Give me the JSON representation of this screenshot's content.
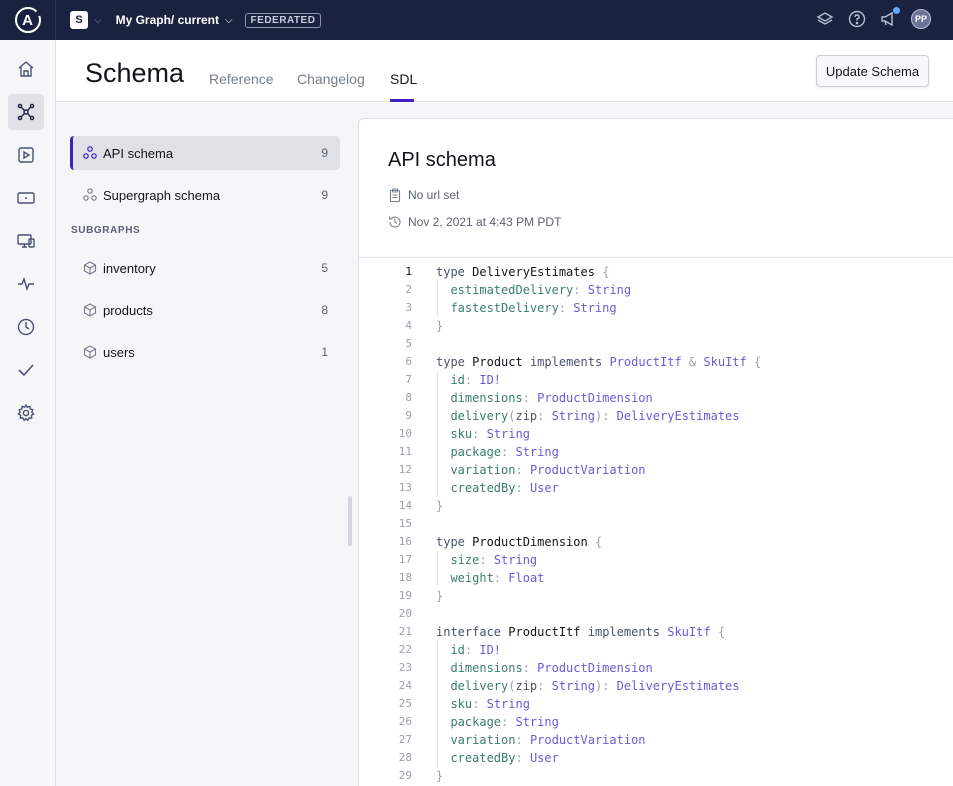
{
  "topbar": {
    "logo_letter": "A",
    "org_initial": "S",
    "graph_name": "My Graph/ current",
    "badge": "FEDERATED",
    "avatar_initials": "PP"
  },
  "header": {
    "title": "Schema",
    "tabs": [
      {
        "label": "Reference",
        "active": false
      },
      {
        "label": "Changelog",
        "active": false
      },
      {
        "label": "SDL",
        "active": true
      }
    ],
    "update_button": "Update Schema"
  },
  "sidebar": {
    "schemas": [
      {
        "label": "API schema",
        "count": "9",
        "active": true
      },
      {
        "label": "Supergraph schema",
        "count": "9",
        "active": false
      }
    ],
    "subgraphs_label": "SUBGRAPHS",
    "subgraphs": [
      {
        "label": "inventory",
        "count": "5"
      },
      {
        "label": "products",
        "count": "8"
      },
      {
        "label": "users",
        "count": "1"
      }
    ]
  },
  "panel": {
    "title": "API schema",
    "url_text": "No url set",
    "timestamp": "Nov 2, 2021 at 4:43 PM PDT"
  },
  "code_lines": [
    "type DeliveryEstimates {",
    "  estimatedDelivery: String",
    "  fastestDelivery: String",
    "}",
    "",
    "type Product implements ProductItf & SkuItf {",
    "  id: ID!",
    "  dimensions: ProductDimension",
    "  delivery(zip: String): DeliveryEstimates",
    "  sku: String",
    "  package: String",
    "  variation: ProductVariation",
    "  createdBy: User",
    "}",
    "",
    "type ProductDimension {",
    "  size: String",
    "  weight: Float",
    "}",
    "",
    "interface ProductItf implements SkuItf {",
    "  id: ID!",
    "  dimensions: ProductDimension",
    "  delivery(zip: String): DeliveryEstimates",
    "  sku: String",
    "  package: String",
    "  variation: ProductVariation",
    "  createdBy: User",
    "}"
  ]
}
